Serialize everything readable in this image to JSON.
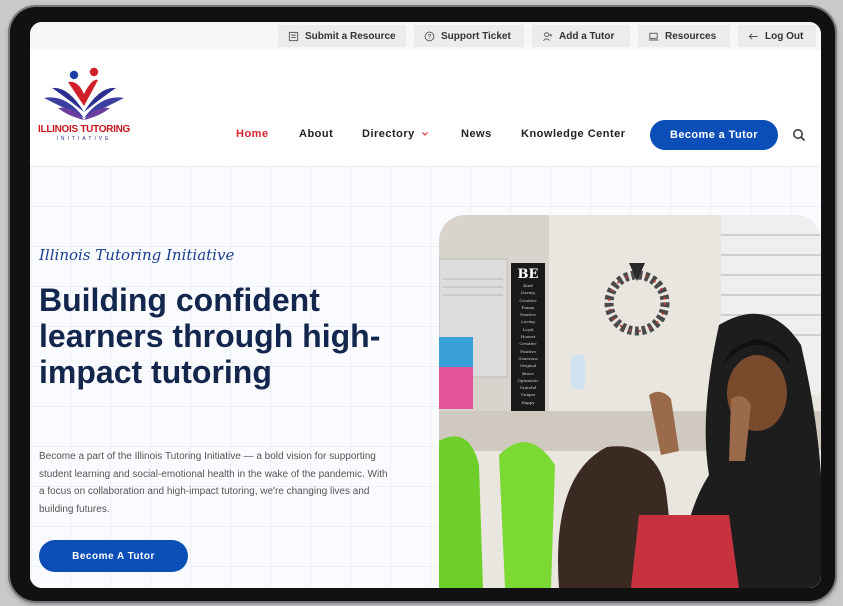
{
  "utility_bar": {
    "items": [
      {
        "label": "Submit a Resource",
        "icon": "document-icon"
      },
      {
        "label": "Support Ticket",
        "icon": "help-circle-icon"
      },
      {
        "label": "Add a Tutor",
        "icon": "add-user-icon"
      },
      {
        "label": "Resources",
        "icon": "laptop-icon"
      },
      {
        "label": "Log Out",
        "icon": "arrow-left-icon"
      }
    ]
  },
  "header": {
    "logo": {
      "title": "ILLINOIS TUTORING",
      "subtitle": "INITIATIVE"
    },
    "nav": [
      {
        "label": "Home",
        "active": true
      },
      {
        "label": "About"
      },
      {
        "label": "Directory",
        "has_dropdown": true
      },
      {
        "label": "News"
      },
      {
        "label": "Knowledge Center"
      }
    ],
    "cta_label": "Become a Tutor",
    "search_icon": "search-icon"
  },
  "hero": {
    "eyebrow": "Illinois Tutoring Initiative",
    "headline": "Building confident learners through high-impact tutoring",
    "body": "Become a part of the Illinois Tutoring Initiative — a bold vision for supporting student learning and social-emotional health in the wake of the pandemic. With a focus on collaboration and high-impact tutoring, we're changing lives and building futures.",
    "cta_label": "Become A Tutor",
    "photo": {
      "board_title": "BE",
      "board_words": [
        "Kind",
        "Daring",
        "Creative",
        "Funny",
        "Positive",
        "Loving",
        "Loyal",
        "Honest",
        "Creative",
        "Positive",
        "Generous",
        "Original",
        "Brave",
        "Optimistic",
        "Grateful",
        "Unique",
        "Happy"
      ]
    }
  },
  "colors": {
    "brand_blue": "#0b4eb8",
    "nav_active": "#d7262e",
    "headline": "#13264d",
    "eyebrow": "#1b3f8f"
  }
}
